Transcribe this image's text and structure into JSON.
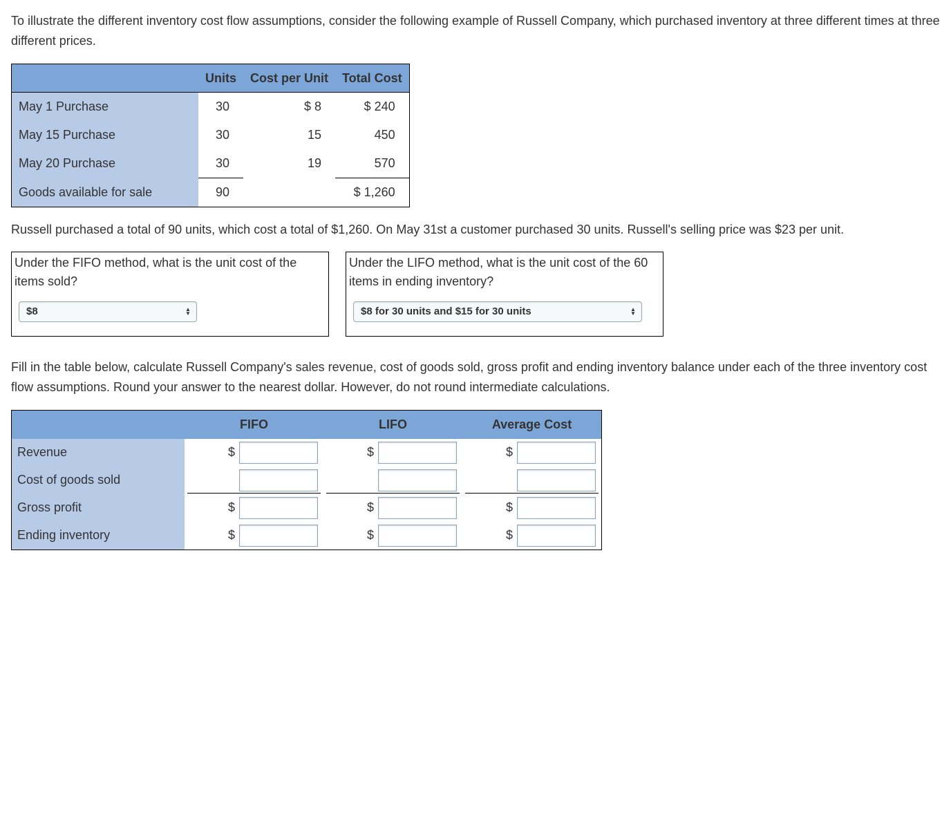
{
  "intro": "To illustrate the different inventory cost flow assumptions, consider the following example of Russell Company, which purchased inventory at three different times at three different prices.",
  "purchase_table": {
    "headers": {
      "c0": "",
      "c1": "Units",
      "c2": "Cost per Unit",
      "c3": "Total Cost"
    },
    "rows": [
      {
        "label": "May 1 Purchase",
        "units": "30",
        "cpu": "$ 8",
        "total": "$ 240"
      },
      {
        "label": "May 15 Purchase",
        "units": "30",
        "cpu": "15",
        "total": "450"
      },
      {
        "label": "May 20 Purchase",
        "units": "30",
        "cpu": "19",
        "total": "570"
      }
    ],
    "footer": {
      "label": "Goods available for sale",
      "units": "90",
      "cpu": "",
      "total": "$ 1,260"
    }
  },
  "para2": "Russell purchased a total of 90 units, which cost a total of $1,260. On May 31st a customer purchased 30 units. Russell's selling price was $23 per unit.",
  "q_fifo": {
    "text": "Under the FIFO method, what is the unit cost of the items sold?",
    "value": "$8"
  },
  "q_lifo": {
    "text": "Under the LIFO method, what is the unit cost of the 60 items in ending inventory?",
    "value": "$8 for 30 units and $15 for 30 units"
  },
  "para3": "Fill in the table below, calculate Russell Company's sales revenue, cost of goods sold, gross profit and ending inventory balance under each of the three inventory cost flow assumptions. Round your answer to the nearest dollar. However, do not round intermediate calculations.",
  "results_table": {
    "headers": {
      "c0": "",
      "c1": "FIFO",
      "c2": "LIFO",
      "c3": "Average Cost"
    },
    "rows": [
      {
        "label": "Revenue",
        "dollars": true
      },
      {
        "label": "Cost of goods sold",
        "dollars": false
      },
      {
        "label": "Gross profit",
        "dollars": true
      },
      {
        "label": "Ending inventory",
        "dollars": true
      }
    ],
    "currency": "$"
  }
}
